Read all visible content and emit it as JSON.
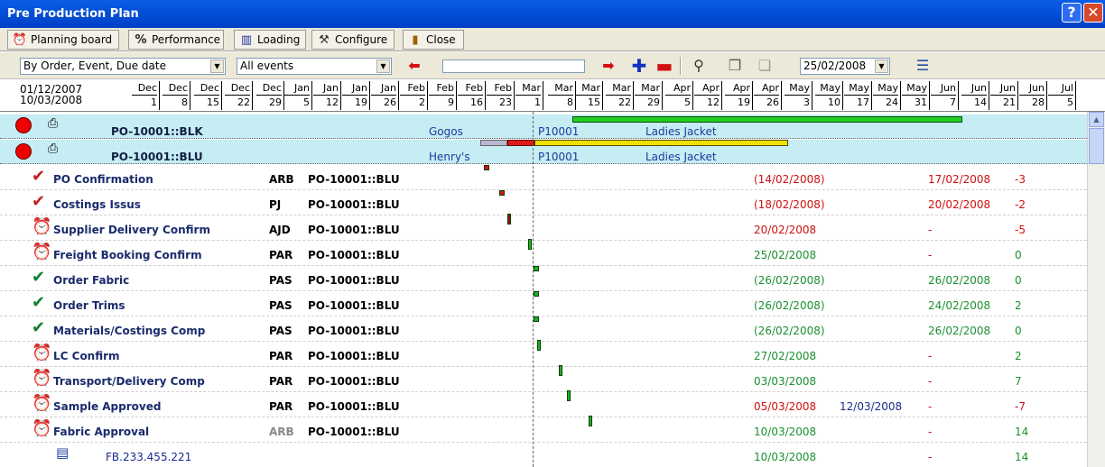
{
  "window": {
    "title": "Pre Production Plan",
    "help": "?",
    "close": "✕"
  },
  "tabs": [
    {
      "label": "Planning board",
      "icon": "alarm-clock-icon"
    },
    {
      "label": "Performance",
      "icon": "percent-icon"
    },
    {
      "label": "Loading",
      "icon": "bar-chart-icon"
    },
    {
      "label": "Configure",
      "icon": "configure-icon"
    },
    {
      "label": "Close",
      "icon": "door-icon"
    }
  ],
  "toolbar": {
    "sort_value": "By Order, Event, Due date",
    "event_filter": "All events",
    "date_value": "25/02/2008",
    "progress_value": ""
  },
  "timeline": {
    "from": "01/12/2007",
    "to": "10/03/2008",
    "months": [
      "Dec",
      "Dec",
      "Dec",
      "Dec",
      "Dec",
      "Jan",
      "Jan",
      "Jan",
      "Jan",
      "Feb",
      "Feb",
      "Feb",
      "Feb",
      "Mar",
      "Mar",
      "Mar",
      "Mar",
      "Mar",
      "Apr",
      "Apr",
      "Apr",
      "Apr",
      "May",
      "May",
      "May",
      "May",
      "May",
      "Jun",
      "Jun",
      "Jun",
      "Jun",
      "Jul"
    ],
    "days": [
      "1",
      "8",
      "15",
      "22",
      "29",
      "5",
      "12",
      "19",
      "26",
      "2",
      "9",
      "16",
      "23",
      "1",
      "8",
      "15",
      "22",
      "29",
      "5",
      "12",
      "19",
      "26",
      "3",
      "10",
      "17",
      "24",
      "31",
      "7",
      "14",
      "21",
      "28",
      "5"
    ]
  },
  "orders": [
    {
      "po": "PO-10001::BLK",
      "customer": "Gogos",
      "style": "P10001",
      "desc": "Ladies Jacket"
    },
    {
      "po": "PO-10001::BLU",
      "customer": "Henry's",
      "style": "P10001",
      "desc": "Ladies Jacket"
    }
  ],
  "events": [
    {
      "name": "PO Confirmation",
      "icon": "check-icon",
      "who": "ARB",
      "po": "PO-10001::BLU",
      "due": "(14/02/2008)",
      "actual": "",
      "done": "17/02/2008",
      "diff": "-3",
      "due_c": "red",
      "done_c": "red",
      "diff_c": "red"
    },
    {
      "name": "Costings Issus",
      "icon": "check-icon",
      "who": "PJ",
      "po": "PO-10001::BLU",
      "due": "(18/02/2008)",
      "actual": "",
      "done": "20/02/2008",
      "diff": "-2",
      "due_c": "red",
      "done_c": "red",
      "diff_c": "red"
    },
    {
      "name": "Supplier Delivery Confirm",
      "icon": "alarm-red-icon",
      "who": "AJD",
      "po": "PO-10001::BLU",
      "due": "20/02/2008",
      "actual": "",
      "done": "-",
      "diff": "-5",
      "due_c": "red",
      "done_c": "red",
      "diff_c": "red"
    },
    {
      "name": "Freight Booking Confirm",
      "icon": "alarm-green-icon",
      "who": "PAR",
      "po": "PO-10001::BLU",
      "due": "25/02/2008",
      "actual": "",
      "done": "-",
      "diff": "0",
      "due_c": "green",
      "done_c": "red",
      "diff_c": "green"
    },
    {
      "name": "Order Fabric",
      "icon": "check-green-icon",
      "who": "PAS",
      "po": "PO-10001::BLU",
      "due": "(26/02/2008)",
      "actual": "",
      "done": "26/02/2008",
      "diff": "0",
      "due_c": "green",
      "done_c": "green",
      "diff_c": "green"
    },
    {
      "name": "Order Trims",
      "icon": "check-green-icon",
      "who": "PAS",
      "po": "PO-10001::BLU",
      "due": "(26/02/2008)",
      "actual": "",
      "done": "24/02/2008",
      "diff": "2",
      "due_c": "green",
      "done_c": "green",
      "diff_c": "green"
    },
    {
      "name": "Materials/Costings Comp",
      "icon": "check-green-icon",
      "who": "PAS",
      "po": "PO-10001::BLU",
      "due": "(26/02/2008)",
      "actual": "",
      "done": "26/02/2008",
      "diff": "0",
      "due_c": "green",
      "done_c": "green",
      "diff_c": "green"
    },
    {
      "name": "LC Confirm",
      "icon": "alarm-green-icon",
      "who": "PAR",
      "po": "PO-10001::BLU",
      "due": "27/02/2008",
      "actual": "",
      "done": "-",
      "diff": "2",
      "due_c": "green",
      "done_c": "red",
      "diff_c": "green"
    },
    {
      "name": "Transport/Delivery Comp",
      "icon": "alarm-green-icon",
      "who": "PAR",
      "po": "PO-10001::BLU",
      "due": "03/03/2008",
      "actual": "",
      "done": "-",
      "diff": "7",
      "due_c": "green",
      "done_c": "red",
      "diff_c": "green"
    },
    {
      "name": "Sample Approved",
      "icon": "alarm-red-icon",
      "who": "PAR",
      "po": "PO-10001::BLU",
      "due": "05/03/2008",
      "actual": "12/03/2008",
      "done": "-",
      "diff": "-7",
      "due_c": "red",
      "done_c": "red",
      "diff_c": "red"
    },
    {
      "name": "Fabric Approval",
      "icon": "alarm-green-icon",
      "who": "ARB",
      "po": "PO-10001::BLU",
      "due": "10/03/2008",
      "actual": "",
      "done": "-",
      "diff": "14",
      "due_c": "green",
      "done_c": "red",
      "diff_c": "green"
    }
  ],
  "subrow": {
    "ref": "FB.233.455.221",
    "due": "10/03/2008",
    "done": "-",
    "diff": "14"
  },
  "colors": {
    "accent": "#0350d8",
    "row_highlight": "#c6ecf4",
    "late": "#d01010",
    "ontime": "#1a9030"
  }
}
